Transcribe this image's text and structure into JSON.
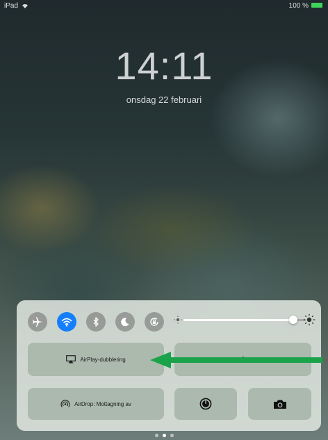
{
  "status_bar": {
    "carrier": "iPad",
    "battery_text": "100 %",
    "battery_level_percent": 100,
    "battery_color": "#3ed35a"
  },
  "lock_screen": {
    "time": "14:11",
    "date": "onsdag 22 februari"
  },
  "control_center": {
    "toggles": [
      {
        "name": "airplane-mode",
        "icon": "airplane-icon",
        "active": false
      },
      {
        "name": "wifi",
        "icon": "wifi-icon",
        "active": true
      },
      {
        "name": "bluetooth",
        "icon": "bluetooth-icon",
        "active": false
      },
      {
        "name": "do-not-disturb",
        "icon": "moon-icon",
        "active": false
      },
      {
        "name": "rotation-lock",
        "icon": "rotation-lock-icon",
        "active": false
      }
    ],
    "brightness_level_percent": 90,
    "airplay_label": "AirPlay-dubblering",
    "airdrop_label": "AirDrop: Mottagning av",
    "night_shift_icon": "sun-icon",
    "timer_icon": "timer-icon",
    "camera_icon": "camera-icon",
    "active_color": "#147efb"
  },
  "annotation": {
    "arrow_color": "#1aa34a"
  },
  "page_indicator": {
    "total": 3,
    "current": 2
  }
}
